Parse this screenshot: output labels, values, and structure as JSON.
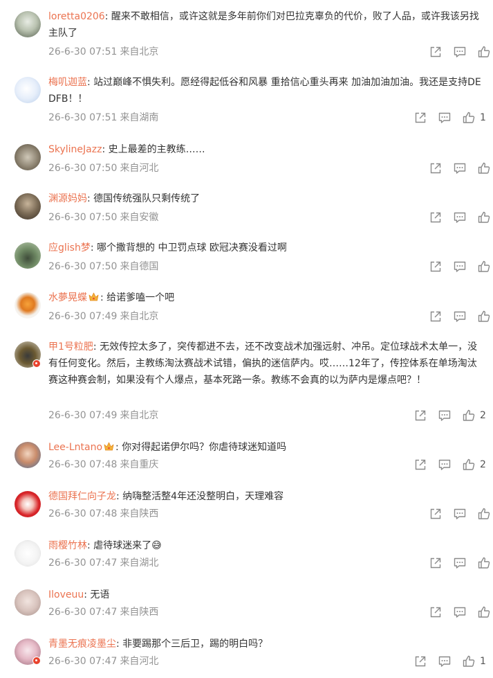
{
  "icons": {
    "share": "share-icon",
    "comment": "comment-icon",
    "like": "thumbs-up-icon"
  },
  "colors": {
    "username": "#eb7350",
    "text": "#333333",
    "meta": "#939393",
    "icon": "#8a8a8a"
  },
  "comments": [
    {
      "user": "loretta0206",
      "text": "醒来不敢相信，或许这就是多年前你们对巴拉克辜负的代价，败了人品，或许我该另找主队了",
      "date": "26-6-30 07:51",
      "location": "来自北京",
      "likes": ""
    },
    {
      "user": "梅叽迦蓝",
      "text": "站过巅峰不惧失利。愿经得起低谷和风暴 重拾信心重头再来 加油加油加油。我还是支持DEDFB！！",
      "date": "26-6-30 07:51",
      "location": "来自湖南",
      "likes": "1"
    },
    {
      "user": "SkylineJazz",
      "text": "史上最差的主教练……",
      "date": "26-6-30 07:50",
      "location": "来自河北",
      "likes": ""
    },
    {
      "user": "渊源妈妈",
      "text": "德国传统强队只剩传统了",
      "date": "26-6-30 07:50",
      "location": "来自安徽",
      "likes": ""
    },
    {
      "user": "应glish梦",
      "text": "哪个撒背想的 中卫罚点球 欧冠决赛没看过啊",
      "date": "26-6-30 07:50",
      "location": "来自德国",
      "likes": ""
    },
    {
      "user": "水夢晃蝶",
      "text": "给诺爹嗑一个吧",
      "date": "26-6-30 07:49",
      "location": "来自北京",
      "likes": ""
    },
    {
      "user": "甲1号粒肥",
      "text": "无效传控太多了，突传都进不去，还不改变战术加强远射、冲吊。定位球战术太单一，没有任何变化。然后，主教练淘汰赛战术试错，偏执的迷信萨内。哎……12年了，传控体系在单场淘汰赛这种赛会制，如果没有个人爆点，基本死路一条。教练不会真的以为萨内是爆点吧？！",
      "date": "26-6-30 07:49",
      "location": "来自北京",
      "likes": "2"
    },
    {
      "user": "Lee-Lntano",
      "text": "你对得起诺伊尔吗？你虐待球迷知道吗",
      "date": "26-6-30 07:48",
      "location": "来自重庆",
      "likes": "2"
    },
    {
      "user": "德国拜仁向子龙",
      "text": "纳嗨整活整4年还没整明白，天理难容",
      "date": "26-6-30 07:48",
      "location": "来自陕西",
      "likes": ""
    },
    {
      "user": "雨樱竹林",
      "text": "虐待球迷来了😅",
      "date": "26-6-30 07:47",
      "location": "来自湖北",
      "likes": ""
    },
    {
      "user": "Iloveuu",
      "text": "无语",
      "date": "26-6-30 07:47",
      "location": "来自陕西",
      "likes": ""
    },
    {
      "user": "青墨无痕凌墨尘",
      "text": "非要踢那个三后卫，踢的明白吗？",
      "date": "26-6-30 07:47",
      "location": "来自河北",
      "likes": "1"
    }
  ]
}
